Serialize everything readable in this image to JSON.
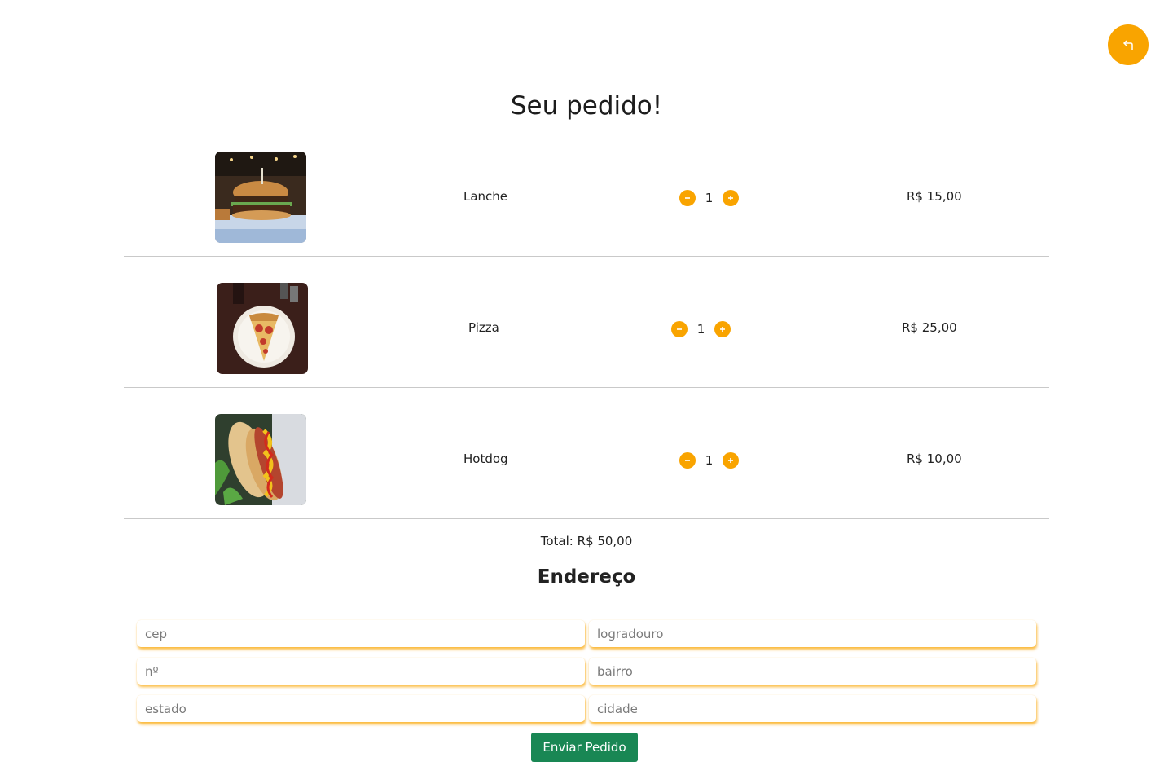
{
  "header": {
    "back_icon": "return-arrow-icon",
    "accent_color": "#f9a400"
  },
  "title": "Seu pedido!",
  "items": [
    {
      "name": "Lanche",
      "quantity": "1",
      "price": "R$ 15,00",
      "image": "burger-photo"
    },
    {
      "name": "Pizza",
      "quantity": "1",
      "price": "R$ 25,00",
      "image": "pizza-photo"
    },
    {
      "name": "Hotdog",
      "quantity": "1",
      "price": "R$ 10,00",
      "image": "hotdog-photo"
    }
  ],
  "total": "Total: R$ 50,00",
  "address": {
    "title": "Endereço",
    "fields": {
      "cep": {
        "placeholder": "cep",
        "value": ""
      },
      "logradouro": {
        "placeholder": "logradouro",
        "value": ""
      },
      "numero": {
        "placeholder": "nº",
        "value": ""
      },
      "bairro": {
        "placeholder": "bairro",
        "value": ""
      },
      "estado": {
        "placeholder": "estado",
        "value": ""
      },
      "cidade": {
        "placeholder": "cidade",
        "value": ""
      }
    }
  },
  "submit_label": "Enviar Pedido",
  "submit_color": "#198754"
}
